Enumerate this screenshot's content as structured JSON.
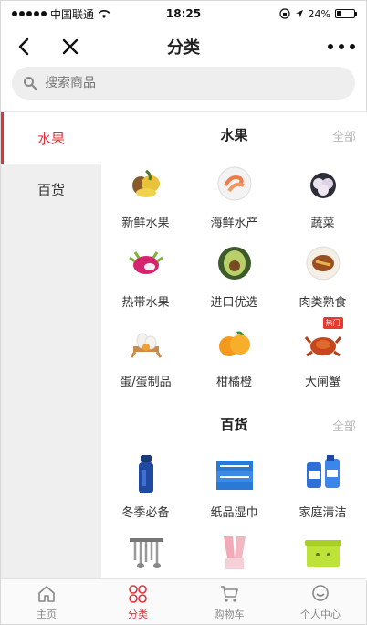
{
  "status_bar": {
    "carrier": "中国联通",
    "time": "18:25",
    "battery": "24%",
    "battery_level": 0.24
  },
  "navbar": {
    "title": "分类"
  },
  "search": {
    "placeholder": "搜索商品"
  },
  "sidebar": {
    "items": [
      {
        "label": "水果",
        "active": true
      },
      {
        "label": "百货",
        "active": false
      }
    ]
  },
  "sections": [
    {
      "title": "水果",
      "all_label": "全部",
      "items": [
        {
          "label": "新鲜水果",
          "icon": "mixed-fruit-icon"
        },
        {
          "label": "海鲜水产",
          "icon": "shrimp-plate-icon"
        },
        {
          "label": "蔬菜",
          "icon": "garlic-icon"
        },
        {
          "label": "热带水果",
          "icon": "dragon-fruit-icon"
        },
        {
          "label": "进口优选",
          "icon": "avocado-icon"
        },
        {
          "label": "肉类熟食",
          "icon": "meat-plate-icon"
        },
        {
          "label": "蛋/蛋制品",
          "icon": "eggs-basket-icon"
        },
        {
          "label": "柑橘橙",
          "icon": "oranges-icon"
        },
        {
          "label": "大闸蟹",
          "icon": "crab-icon",
          "badge": "热门"
        }
      ]
    },
    {
      "title": "百货",
      "all_label": "全部",
      "items": [
        {
          "label": "冬季必备",
          "icon": "thermos-icon"
        },
        {
          "label": "纸品湿巾",
          "icon": "tissue-pack-icon"
        },
        {
          "label": "家庭清洁",
          "icon": "detergent-icon"
        },
        {
          "label": "",
          "icon": "kitchen-utensils-icon"
        },
        {
          "label": "",
          "icon": "rubber-gloves-icon"
        },
        {
          "label": "",
          "icon": "storage-box-icon"
        }
      ]
    }
  ],
  "tabbar": {
    "items": [
      {
        "label": "主页",
        "icon": "home-icon",
        "active": false
      },
      {
        "label": "分类",
        "icon": "category-icon",
        "active": true
      },
      {
        "label": "购物车",
        "icon": "cart-icon",
        "active": false
      },
      {
        "label": "个人中心",
        "icon": "profile-icon",
        "active": false
      }
    ]
  },
  "colors": {
    "accent": "#e0323c",
    "sidebar_bg": "#efefef",
    "search_bg": "#eeeeee"
  }
}
